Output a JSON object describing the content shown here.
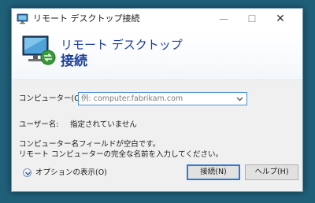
{
  "window": {
    "title": "リモート デスクトップ接続"
  },
  "titlebar_buttons": {
    "minimize": "—",
    "maximize": "☐",
    "close": "✕"
  },
  "banner": {
    "line1": "リモート デスクトップ",
    "line2": "接続"
  },
  "form": {
    "computer_label": "コンピューター(C):",
    "computer_placeholder": "例: computer.fabrikam.com",
    "username_label": "ユーザー名:",
    "username_value": "指定されていません",
    "message_line1": "コンピューター名フィールドが空白です。",
    "message_line2": "リモート コンピューターの完全な名前を入力してください。"
  },
  "footer": {
    "options_label": "オプションの表示(O)",
    "connect_label": "接続(N)",
    "help_label": "ヘルプ(H)"
  },
  "icons": {
    "title": "remote-desktop-icon",
    "banner": "remote-desktop-monitor-icon",
    "combo": "chevron-down-icon",
    "options": "expand-options-icon"
  },
  "colors": {
    "banner_text": "#1d3f9a",
    "focus_border": "#4a8fd6",
    "default_button_border": "#2f7ad3",
    "desktop": "#1f5f78"
  }
}
